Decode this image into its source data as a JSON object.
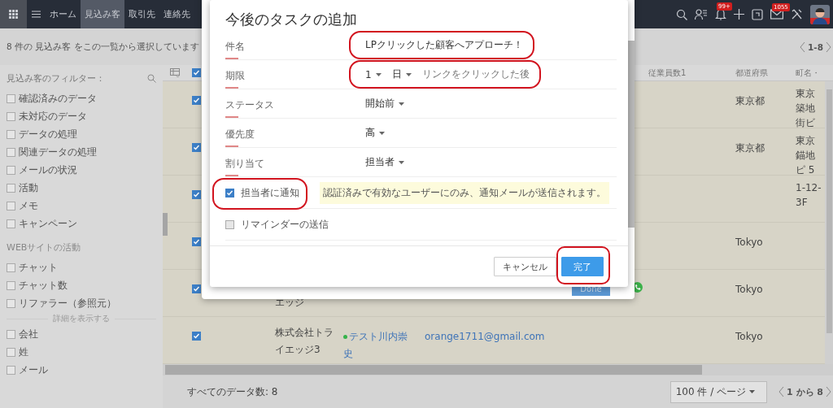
{
  "topbar": {
    "tabs": [
      {
        "label": "ホーム",
        "selected": false
      },
      {
        "label": "見込み客",
        "selected": true
      },
      {
        "label": "取引先",
        "selected": false
      },
      {
        "label": "連絡先",
        "selected": false
      }
    ],
    "notification_badge": "99+",
    "mail_badge": "1055"
  },
  "selection_bar": {
    "text": "8 件の 見込み客 をこの一覧から選択しています",
    "pager": "1-8"
  },
  "sidebar": {
    "title": "見込み客のフィルター：",
    "sections": [
      {
        "items": [
          {
            "label": "確認済みのデータ",
            "checked": false
          },
          {
            "label": "未対応のデータ",
            "checked": false
          },
          {
            "label": "データの処理",
            "checked": false
          },
          {
            "label": "関連データの処理",
            "checked": false
          },
          {
            "label": "メールの状況",
            "checked": false
          },
          {
            "label": "活動",
            "checked": false
          },
          {
            "label": "メモ",
            "checked": false
          },
          {
            "label": "キャンペーン",
            "checked": false
          }
        ]
      },
      {
        "heading": "WEBサイトの活動",
        "items": [
          {
            "label": "チャット",
            "checked": false
          },
          {
            "label": "チャット数",
            "checked": false
          },
          {
            "label": "リファラー（参照元）",
            "checked": false
          }
        ]
      },
      {
        "divider": "詳細を表示する",
        "items": [
          {
            "label": "会社",
            "checked": false
          },
          {
            "label": "姓",
            "checked": false
          },
          {
            "label": "メール",
            "checked": false
          }
        ]
      }
    ]
  },
  "table": {
    "select_all": true,
    "columns": [
      "従業員数1",
      "都道府県",
      "町名・"
    ],
    "rows": [
      {
        "selected": true,
        "prefecture": "東京都",
        "town": "東京築地街ビ"
      },
      {
        "selected": true,
        "prefecture": "東京都",
        "town": "東京錨地ピ 5"
      },
      {
        "selected": true,
        "town": "1-12-3F"
      },
      {
        "selected": true,
        "prefecture": "Tokyo"
      },
      {
        "selected": true,
        "company": "エッジ",
        "phone": true,
        "prefecture": "Tokyo"
      },
      {
        "selected": true,
        "company": "株式会社トライエッジ3",
        "contact": "テスト川内崇史",
        "email": "orange1711@gmail.com",
        "prefecture": "Tokyo"
      }
    ]
  },
  "footer": {
    "total": "すべてのデータ数: 8",
    "per_page": "100 件 / ページ",
    "pager": "1 から 8"
  },
  "background_dialog": {
    "button": "Done"
  },
  "dialog": {
    "title": "今後のタスクの追加",
    "fields": [
      {
        "kind": "text",
        "label": "件名",
        "value": "LPクリックした顧客へアプローチ！",
        "circled": true
      },
      {
        "kind": "due",
        "label": "期限",
        "number": "1",
        "unit": "日",
        "trigger": "リンクをクリックした後",
        "circled": true
      },
      {
        "kind": "select",
        "label": "ステータス",
        "value": "開始前",
        "circled": false
      },
      {
        "kind": "select",
        "label": "優先度",
        "value": "高",
        "circled": false
      },
      {
        "kind": "select",
        "label": "割り当て",
        "value": "担当者",
        "circled": false
      },
      {
        "kind": "checkbox",
        "label": "担当者に通知",
        "checked": true,
        "note": "認証済みで有効なユーザーにのみ、通知メールが送信されます。",
        "circled": true
      },
      {
        "kind": "checkbox",
        "label": "リマインダーの送信",
        "checked": false,
        "circled": false
      }
    ],
    "buttons": [
      {
        "label": "キャンセル",
        "kind": "secondary",
        "circled": false
      },
      {
        "label": "完了",
        "kind": "primary",
        "circled": true
      }
    ]
  }
}
